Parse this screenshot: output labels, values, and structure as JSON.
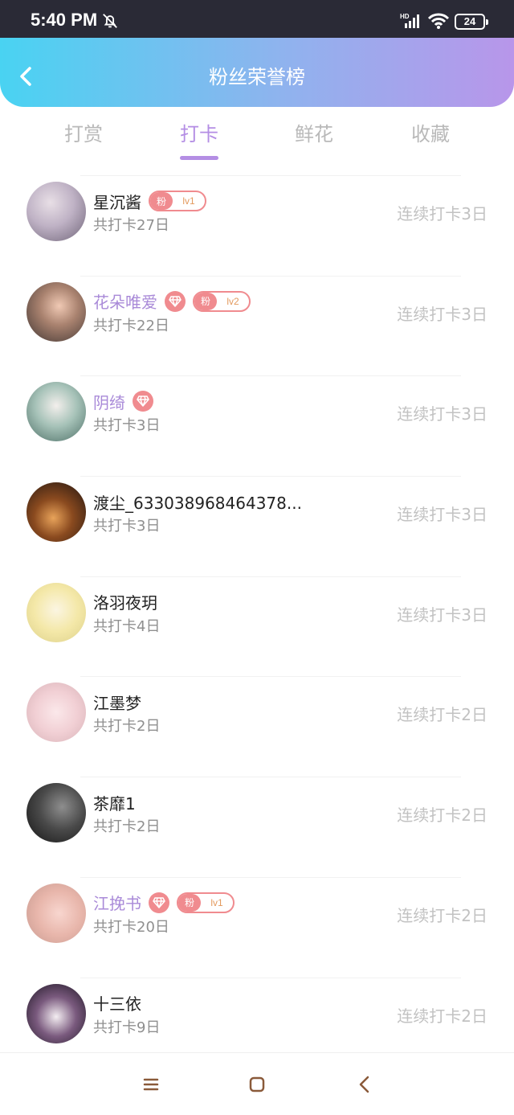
{
  "status_bar": {
    "time": "5:40 PM",
    "battery": "24"
  },
  "header": {
    "title": "粉丝荣誉榜"
  },
  "tabs": [
    {
      "label": "打赏",
      "active": false
    },
    {
      "label": "打卡",
      "active": true
    },
    {
      "label": "鲜花",
      "active": false
    },
    {
      "label": "收藏",
      "active": false
    }
  ],
  "list": [
    {
      "name": "星沉酱",
      "vip": false,
      "diamond": false,
      "fan_tag": "粉",
      "fan_level": "lv1",
      "total": "共打卡27日",
      "streak": "连续打卡3日"
    },
    {
      "name": "花朵唯爱",
      "vip": true,
      "diamond": true,
      "fan_tag": "粉",
      "fan_level": "lv2",
      "total": "共打卡22日",
      "streak": "连续打卡3日"
    },
    {
      "name": "阴绮",
      "vip": true,
      "diamond": true,
      "fan_tag": "",
      "fan_level": "",
      "total": "共打卡3日",
      "streak": "连续打卡3日"
    },
    {
      "name": "渡尘_633038968464378...",
      "vip": false,
      "diamond": false,
      "fan_tag": "",
      "fan_level": "",
      "total": "共打卡3日",
      "streak": "连续打卡3日"
    },
    {
      "name": "洛羽夜玥",
      "vip": false,
      "diamond": false,
      "fan_tag": "",
      "fan_level": "",
      "total": "共打卡4日",
      "streak": "连续打卡3日"
    },
    {
      "name": "江墨梦",
      "vip": false,
      "diamond": false,
      "fan_tag": "",
      "fan_level": "",
      "total": "共打卡2日",
      "streak": "连续打卡2日"
    },
    {
      "name": "茶靡1",
      "vip": false,
      "diamond": false,
      "fan_tag": "",
      "fan_level": "",
      "total": "共打卡2日",
      "streak": "连续打卡2日"
    },
    {
      "name": "江挽书",
      "vip": true,
      "diamond": true,
      "fan_tag": "粉",
      "fan_level": "lv1",
      "total": "共打卡20日",
      "streak": "连续打卡2日"
    },
    {
      "name": "十三依",
      "vip": false,
      "diamond": false,
      "fan_tag": "",
      "fan_level": "",
      "total": "共打卡9日",
      "streak": "连续打卡2日"
    }
  ],
  "colors": {
    "accent": "#b48ee4",
    "badge": "#f08b8f",
    "header_gradient_start": "#49d3f2",
    "header_gradient_end": "#b896ea"
  }
}
